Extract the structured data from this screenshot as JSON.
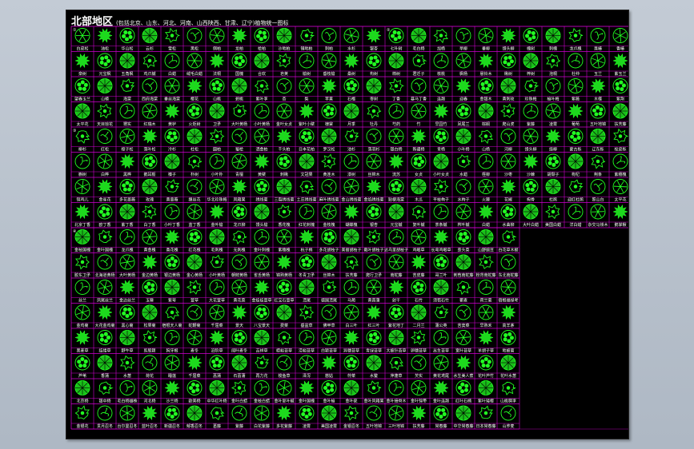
{
  "app": {
    "title": "北部地区",
    "subtitle": "(包括北京、山东、河北、河南、山西陕西、甘肃、辽宁)植物统一图标"
  },
  "section_tags": [
    "①",
    "②",
    "③",
    "④"
  ],
  "colors": {
    "symbol": "#22ff22",
    "grid": "#d000d0",
    "label": "#ffffff",
    "background": "#000000"
  },
  "right_block_labels": [
    [
      "白皮松",
      "油松",
      "华山松",
      "云杉",
      "雪松",
      "黑松",
      "侧柏",
      "龙柏",
      "桧柏",
      "沙地柏",
      "铺地柏",
      "刺柏",
      "水杉",
      "银杏",
      "七叶树",
      "毛白杨",
      "加杨",
      "旱柳",
      "垂柳",
      "馒头柳",
      "槐树",
      "刺槐",
      "龙爪槐",
      "臭椿",
      "香椿",
      "千头椿"
    ],
    [
      "栾树",
      "元宝枫",
      "五角枫",
      "鸡爪槭",
      "白蜡",
      "绒毛白蜡",
      "法桐",
      "国槐",
      "合欢",
      "皂荚",
      "榆树",
      "垂枝榆",
      "桑树",
      "构树",
      "柿树",
      "君迁子",
      "核桃",
      "枫杨",
      "悬铃木",
      "楸树",
      "梓树",
      "泡桐",
      "杜仲",
      "玉兰",
      "紫玉兰",
      "二乔玉兰"
    ],
    [
      "望春玉兰",
      "山楂",
      "海棠",
      "西府海棠",
      "垂丝海棠",
      "樱花",
      "山桃",
      "碧桃",
      "紫叶李",
      "杏",
      "梨",
      "苹果",
      "石榴",
      "枣树",
      "丁香",
      "暴马丁香",
      "连翘",
      "迎春",
      "金银木",
      "黄刺玫",
      "珍珠梅",
      "榆叶梅",
      "紫薇",
      "木槿",
      "紫荆",
      "锦带"
    ],
    [
      "太平花",
      "天目琼花",
      "猬实",
      "红瑞木",
      "黄栌",
      "火炬树",
      "卫矛",
      "大叶黄杨",
      "小叶黄杨",
      "金叶女贞",
      "紫叶小檗",
      "棣棠",
      "月季",
      "牡丹",
      "芍药",
      "竹",
      "早园竹",
      "凤尾兰",
      "棕榈",
      "爬山虎",
      "紫藤",
      "凌霄",
      "葡萄",
      "五叶地锦",
      "扶芳藤",
      "草坪"
    ],
    [
      "柳杉",
      "红松",
      "樟子松",
      "落叶松",
      "冷杉",
      "杜松",
      "圆柏",
      "蜀桧",
      "洒金柏",
      "千头柏",
      "日本花柏",
      "罗汉松",
      "池杉",
      "落羽杉",
      "银白杨",
      "新疆杨",
      "青杨",
      "小叶杨",
      "山杨",
      "河柳",
      "馒头柳",
      "绦柳",
      "蒙古栎",
      "辽东栎",
      "栓皮栎",
      "麻栎"
    ],
    [
      "槲树",
      "白桦",
      "黑桦",
      "鹅耳枥",
      "榛子",
      "朴树",
      "小叶朴",
      "青檀",
      "黄檗",
      "刺楸",
      "文冠果",
      "黄连木",
      "漆树",
      "丝棉木",
      "流苏",
      "女贞",
      "小叶女贞",
      "水蜡",
      "柽柳",
      "沙枣",
      "沙棘",
      "胡颓子",
      "枸杞",
      "荆条",
      "紫穗槐",
      "胡枝子"
    ],
    [
      "锦鸡儿",
      "金雀花",
      "多花蔷薇",
      "玫瑰",
      "黄蔷薇",
      "缫丝花",
      "华北珍珠梅",
      "风箱果",
      "绣线菊",
      "三裂绣线菊",
      "土庄绣线菊",
      "麻叶绣线菊",
      "金山绣线菊",
      "金焰绣线菊",
      "贴梗海棠",
      "木瓜",
      "平枝栒子",
      "水栒子",
      "火棘",
      "花椒",
      "枸骨",
      "杜鹃",
      "迎红杜鹃",
      "照山白",
      "太平花",
      "溲疏"
    ],
    [
      "北京丁香",
      "欧丁香",
      "紫丁香",
      "白丁香",
      "小叶丁香",
      "蓝丁香",
      "金叶榆",
      "龙爪柳",
      "馒头榆",
      "香花槐",
      "红花刺槐",
      "金枝槐",
      "蝴蝶槐",
      "银杏",
      "元宝槭",
      "复叶槭",
      "茶条槭",
      "梣叶槭",
      "白蜡",
      "水曲柳",
      "大叶白蜡",
      "美国白蜡",
      "洋白蜡",
      "杂交马褂木",
      "鹅掌楸",
      "含笑"
    ]
  ],
  "left_block_labels": [
    [
      "金枝国槐",
      "金叶国槐",
      "龙爪槐",
      "黄金槐",
      "香花槐",
      "红花槐",
      "毛刺槐",
      "无刺槐",
      "金叶刺槐",
      "紫穗槐",
      "杭子梢",
      "多花胡枝子",
      "美丽胡枝子",
      "截叶胡枝子",
      "达乌里胡枝子",
      "鸡眼草",
      "长萼鸡眼草",
      "歪头菜",
      "山野豌豆",
      "白花草木樨"
    ],
    [
      "胶东卫矛",
      "北海道黄杨",
      "大叶黄杨",
      "金边黄杨",
      "银边黄杨",
      "金心黄杨",
      "小叶黄杨",
      "朝鲜黄杨",
      "雀舌黄杨",
      "锦熟黄杨",
      "冬青卫矛",
      "丝棉木",
      "扶芳藤",
      "爬行卫矛",
      "南蛇藤",
      "苦皮藤",
      "哥兰叶",
      "刺苞南蛇藤",
      "粉背南蛇藤",
      "东北南蛇藤"
    ],
    [
      "丝兰",
      "凤尾丝兰",
      "金边丝兰",
      "玉簪",
      "紫萼",
      "萱草",
      "大花萱草",
      "黄花菜",
      "金娃娃萱草",
      "红宝石萱草",
      "鸢尾",
      "德国鸢尾",
      "马蔺",
      "黄菖蒲",
      "射干",
      "石竹",
      "须苞石竹",
      "瞿麦",
      "荷兰菊",
      "宿根福禄考"
    ],
    [
      "金鸡菊",
      "大花金鸡菊",
      "黑心菊",
      "松果菊",
      "宿根天人菊",
      "蛇鞭菊",
      "千屈菜",
      "景天",
      "八宝景天",
      "费菜",
      "垂盆草",
      "佛甲草",
      "白三叶",
      "红三叶",
      "紫花地丁",
      "二月兰",
      "蒲公英",
      "苦荬菜",
      "早熟禾",
      "高羊茅"
    ],
    [
      "黑麦草",
      "结缕草",
      "野牛草",
      "剪股颖",
      "狗牙根",
      "麦冬",
      "沿阶草",
      "阔叶麦冬",
      "吉祥草",
      "崂峪苔草",
      "涝峪苔草",
      "白颖苔草",
      "异穗苔草",
      "青绿苔草",
      "大披针苔草",
      "卵穗苔草",
      "丛生苔草",
      "宽叶苔草",
      "羊胡子草",
      "地被菊"
    ],
    [
      "芦苇",
      "香蒲",
      "水葱",
      "荷花",
      "睡莲",
      "千屈菜",
      "菖蒲",
      "石菖蒲",
      "再力花",
      "梭鱼草",
      "泽泻",
      "慈姑",
      "荇菜",
      "水鳖",
      "萍蓬草",
      "芡实",
      "黄花鸢尾",
      "水生美人蕉",
      "花叶芦竹",
      "花叶水葱"
    ],
    [
      "北京杨",
      "银中杨",
      "毛白杨雄株",
      "河北杨",
      "沙兰杨",
      "欧美杨",
      "中华红叶杨",
      "金叶白蜡",
      "金枝白蜡",
      "金叶复叶槭",
      "金叶国槐",
      "金叶榆",
      "金叶莸",
      "金叶风箱果",
      "金叶接骨木",
      "金叶锦带",
      "金叶连翘",
      "红叶石楠",
      "紫叶矮樱",
      "山桃稠李"
    ],
    [
      "金银花",
      "贯月忍冬",
      "台尔曼忍冬",
      "蓝叶忍冬",
      "新疆忍冬",
      "郁香忍冬",
      "葛藤",
      "紫藤",
      "白花紫藤",
      "多花紫藤",
      "凌霄",
      "美国凌霄",
      "金银忍冬",
      "五叶地锦",
      "三叶地锦",
      "扶芳藤",
      "常春藤",
      "中华常春藤",
      "日本常春藤",
      "山荞麦"
    ]
  ]
}
